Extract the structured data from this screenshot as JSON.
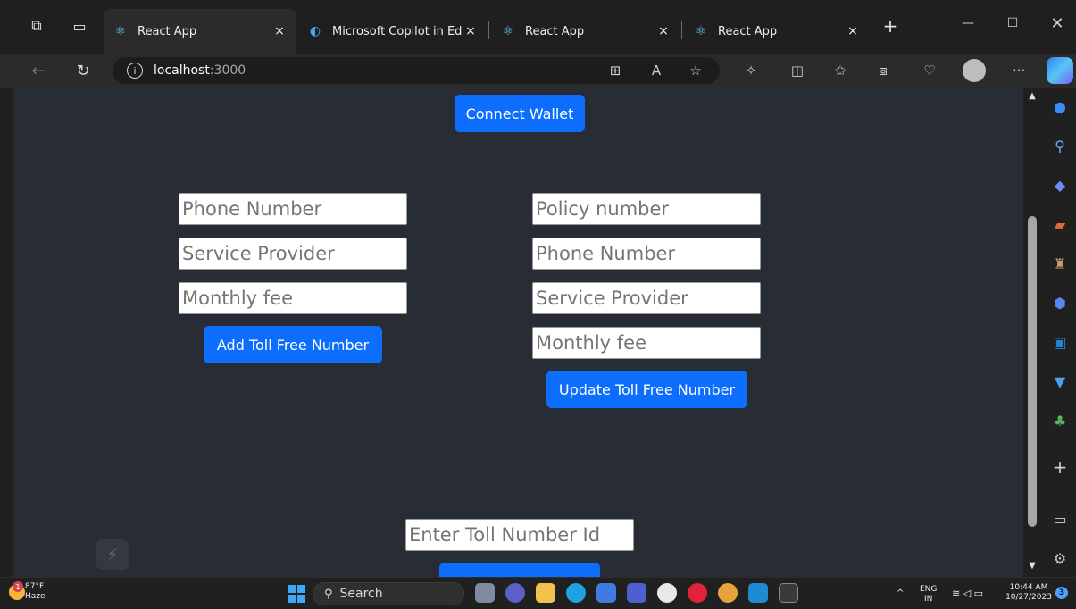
{
  "browser": {
    "tabs": [
      {
        "label": "React App",
        "active": true
      },
      {
        "label": "Microsoft Copilot in Edg",
        "active": false
      },
      {
        "label": "React App",
        "active": false
      },
      {
        "label": "React App",
        "active": false
      }
    ],
    "tab_close_glyph": "×",
    "new_tab_glyph": "+",
    "address": {
      "host": "localhost",
      "port": ":3000"
    },
    "more_glyph": "···"
  },
  "page": {
    "connect_wallet_label": "Connect Wallet",
    "add_form": {
      "phone_placeholder": "Phone Number",
      "provider_placeholder": "Service Provider",
      "fee_placeholder": "Monthly fee",
      "submit_label": "Add Toll Free Number"
    },
    "update_form": {
      "policy_placeholder": "Policy number",
      "phone_placeholder": "Phone Number",
      "provider_placeholder": "Service Provider",
      "fee_placeholder": "Monthly fee",
      "submit_label": "Update Toll Free Number"
    },
    "lookup": {
      "id_placeholder": "Enter Toll Number Id",
      "submit_label": ""
    }
  },
  "taskbar": {
    "weather": {
      "temp": "87°F",
      "condition": "Haze",
      "badge": "1"
    },
    "search_label": "Search",
    "language": {
      "code": "ENG",
      "region": "IN"
    },
    "time": "10:44 AM",
    "date": "10/27/2023",
    "notification_count": "3"
  },
  "colors": {
    "page_bg": "#282c34",
    "primary_button": "#0d6efd",
    "chrome_bg": "#1f1f1f"
  }
}
